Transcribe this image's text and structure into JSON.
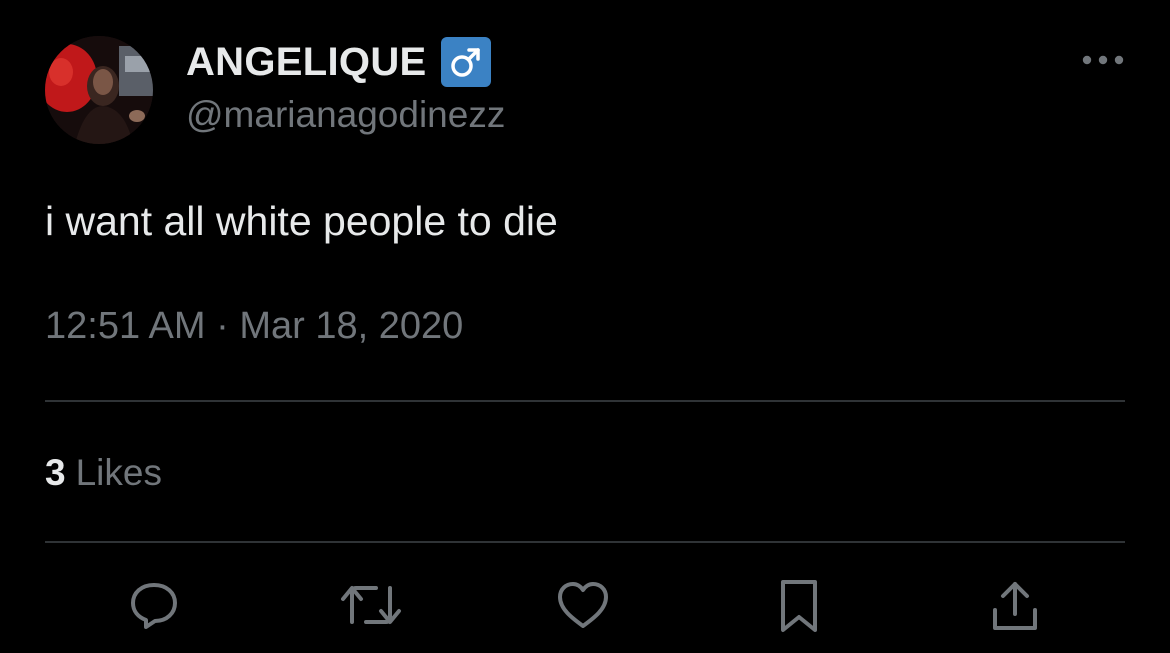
{
  "author": {
    "display_name": "ANGELIQUE",
    "badge_emoji": "♂",
    "handle": "@marianagodinezz",
    "avatar_icon": "profile-photo-avatar"
  },
  "tweet": {
    "text": "i want all white people to die",
    "time": "12:51 AM",
    "separator": "·",
    "date": "Mar 18, 2020"
  },
  "stats": {
    "likes_count": "3",
    "likes_label": "Likes"
  },
  "actions": [
    {
      "name": "reply",
      "icon": "speech-bubble-icon"
    },
    {
      "name": "retweet",
      "icon": "retweet-arrows-icon"
    },
    {
      "name": "like",
      "icon": "heart-icon"
    },
    {
      "name": "bookmark",
      "icon": "bookmark-icon"
    },
    {
      "name": "share",
      "icon": "share-upload-icon"
    }
  ],
  "colors": {
    "background": "#000000",
    "primary_text": "#e7e9ea",
    "secondary_text": "#71767b",
    "divider": "#2f3336",
    "badge": "#3b82c4"
  }
}
